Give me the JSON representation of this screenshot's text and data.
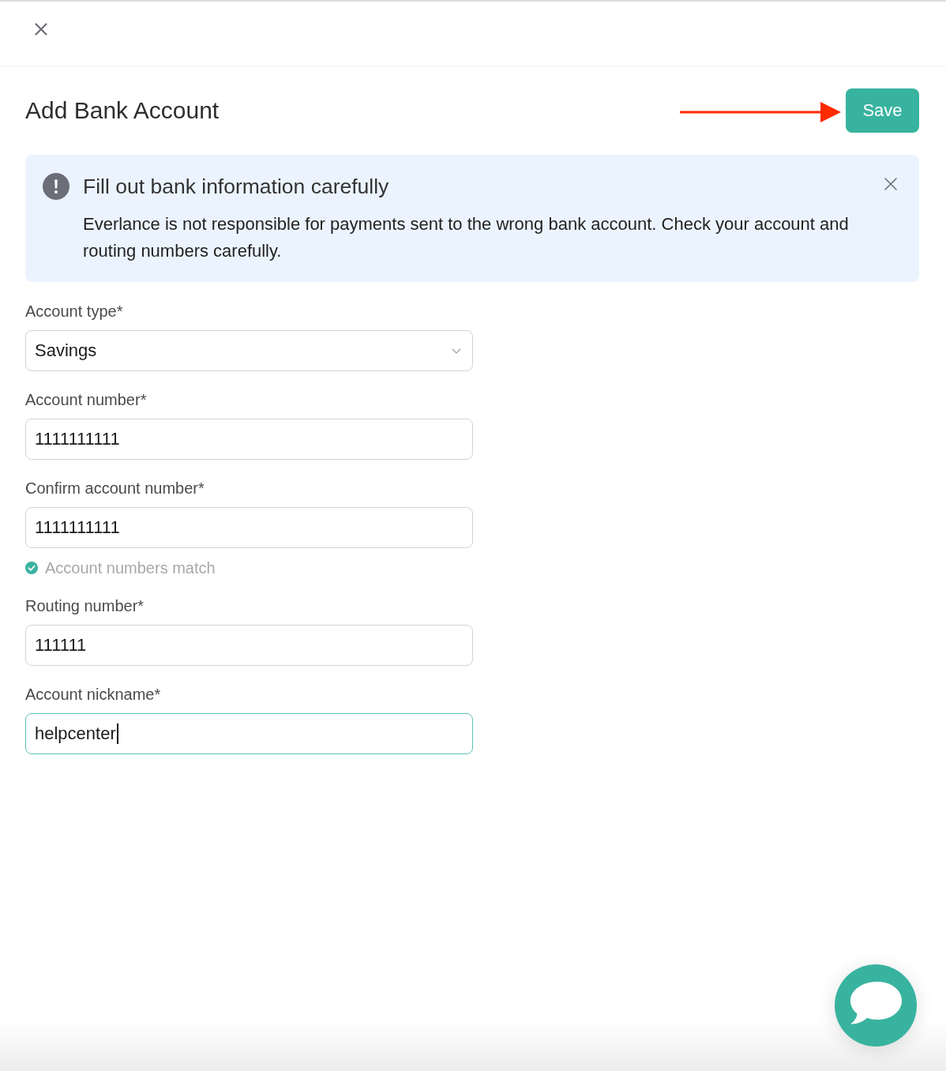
{
  "title": "Add Bank Account",
  "save_button": "Save",
  "alert": {
    "title": "Fill out bank information carefully",
    "message": "Everlance is not responsible for payments sent to the wrong bank account. Check your account and routing numbers carefully."
  },
  "fields": [
    {
      "label": "Account type*",
      "kind": "select",
      "value": "Savings",
      "focused": false
    },
    {
      "label": "Account number*",
      "kind": "text",
      "value": "1111111111",
      "focused": false
    },
    {
      "label": "Confirm account number*",
      "kind": "text",
      "value": "1111111111",
      "focused": false,
      "hint": "Account numbers match"
    },
    {
      "label": "Routing number*",
      "kind": "text",
      "value": "111111",
      "focused": false
    },
    {
      "label": "Account nickname*",
      "kind": "text",
      "value": "helpcenter",
      "focused": true
    }
  ]
}
